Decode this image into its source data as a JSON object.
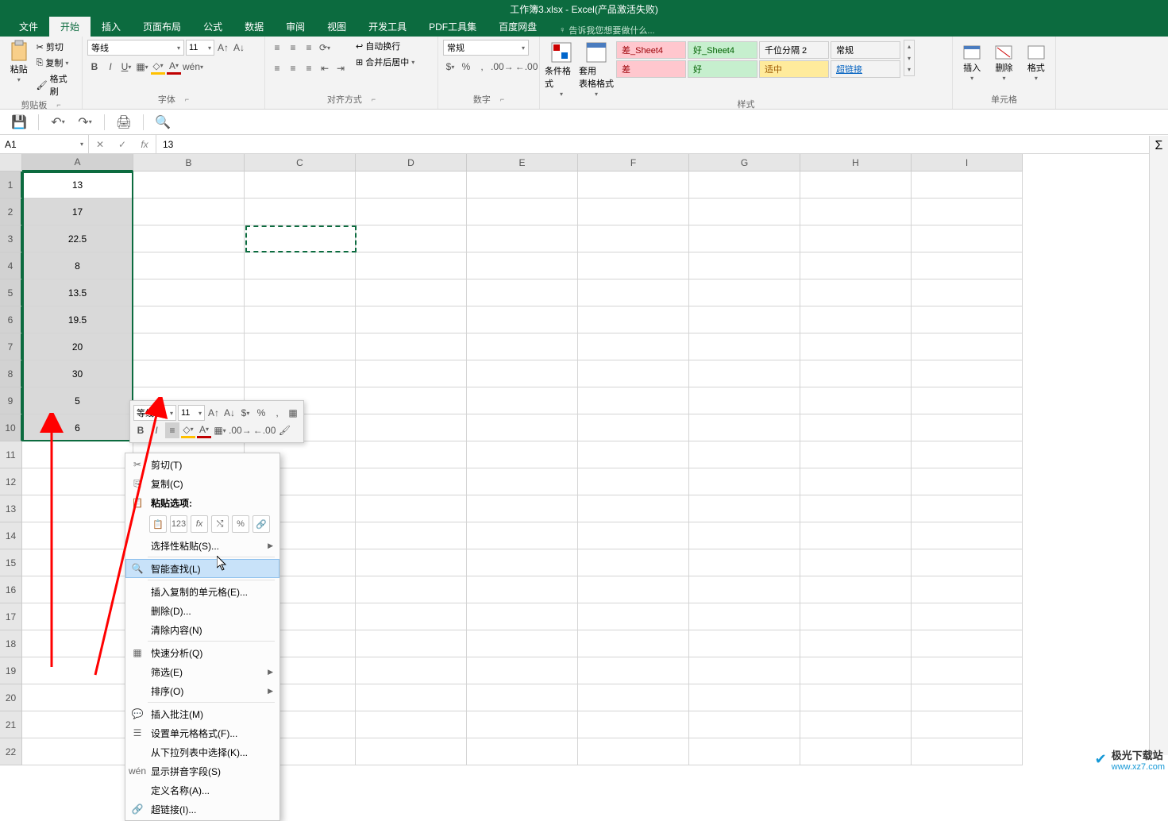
{
  "title": "工作簿3.xlsx - Excel(产品激活失败)",
  "tabs": [
    "文件",
    "开始",
    "插入",
    "页面布局",
    "公式",
    "数据",
    "审阅",
    "视图",
    "开发工具",
    "PDF工具集",
    "百度网盘"
  ],
  "active_tab": "开始",
  "tell_me": "告诉我您想要做什么...",
  "ribbon": {
    "clipboard": {
      "paste": "粘贴",
      "cut": "剪切",
      "copy": "复制",
      "format_painter": "格式刷",
      "label": "剪贴板"
    },
    "font": {
      "name": "等线",
      "size": "11",
      "label": "字体"
    },
    "alignment": {
      "wrap": "自动换行",
      "merge": "合并后居中",
      "label": "对齐方式"
    },
    "number": {
      "format": "常规",
      "label": "数字"
    },
    "styles": {
      "cond": "条件格式",
      "table": "套用\n表格格式",
      "cells": [
        [
          "差_Sheet4",
          "好_Sheet4",
          "千位分隔 2",
          "常规"
        ],
        [
          "差",
          "好",
          "适中",
          "超链接"
        ]
      ],
      "label": "样式"
    },
    "cells_group": {
      "insert": "插入",
      "delete": "删除",
      "format": "格式",
      "label": "单元格"
    }
  },
  "namebox": "A1",
  "formula": "13",
  "columns": [
    "A",
    "B",
    "C",
    "D",
    "E",
    "F",
    "G",
    "H",
    "I"
  ],
  "rows": [
    1,
    2,
    3,
    4,
    5,
    6,
    7,
    8,
    9,
    10,
    11,
    12,
    13,
    14,
    15,
    16,
    17,
    18,
    19,
    20,
    21,
    22
  ],
  "data_a": [
    "13",
    "17",
    "22.5",
    "8",
    "13.5",
    "19.5",
    "20",
    "30",
    "5",
    "6"
  ],
  "mini": {
    "font": "等线",
    "size": "11"
  },
  "ctx": {
    "cut": "剪切(T)",
    "copy": "复制(C)",
    "paste_header": "粘贴选项:",
    "paste_special": "选择性粘贴(S)...",
    "smart_lookup": "智能查找(L)",
    "insert_copied": "插入复制的单元格(E)...",
    "delete": "删除(D)...",
    "clear": "清除内容(N)",
    "quick": "快速分析(Q)",
    "filter": "筛选(E)",
    "sort": "排序(O)",
    "insert_comment": "插入批注(M)",
    "format_cells": "设置单元格格式(F)...",
    "dropdown": "从下拉列表中选择(K)...",
    "phonetic": "显示拼音字段(S)",
    "define_name": "定义名称(A)...",
    "hyperlink": "超链接(I)..."
  },
  "watermark": {
    "brand": "极光下载站",
    "url": "www.xz7.com"
  }
}
